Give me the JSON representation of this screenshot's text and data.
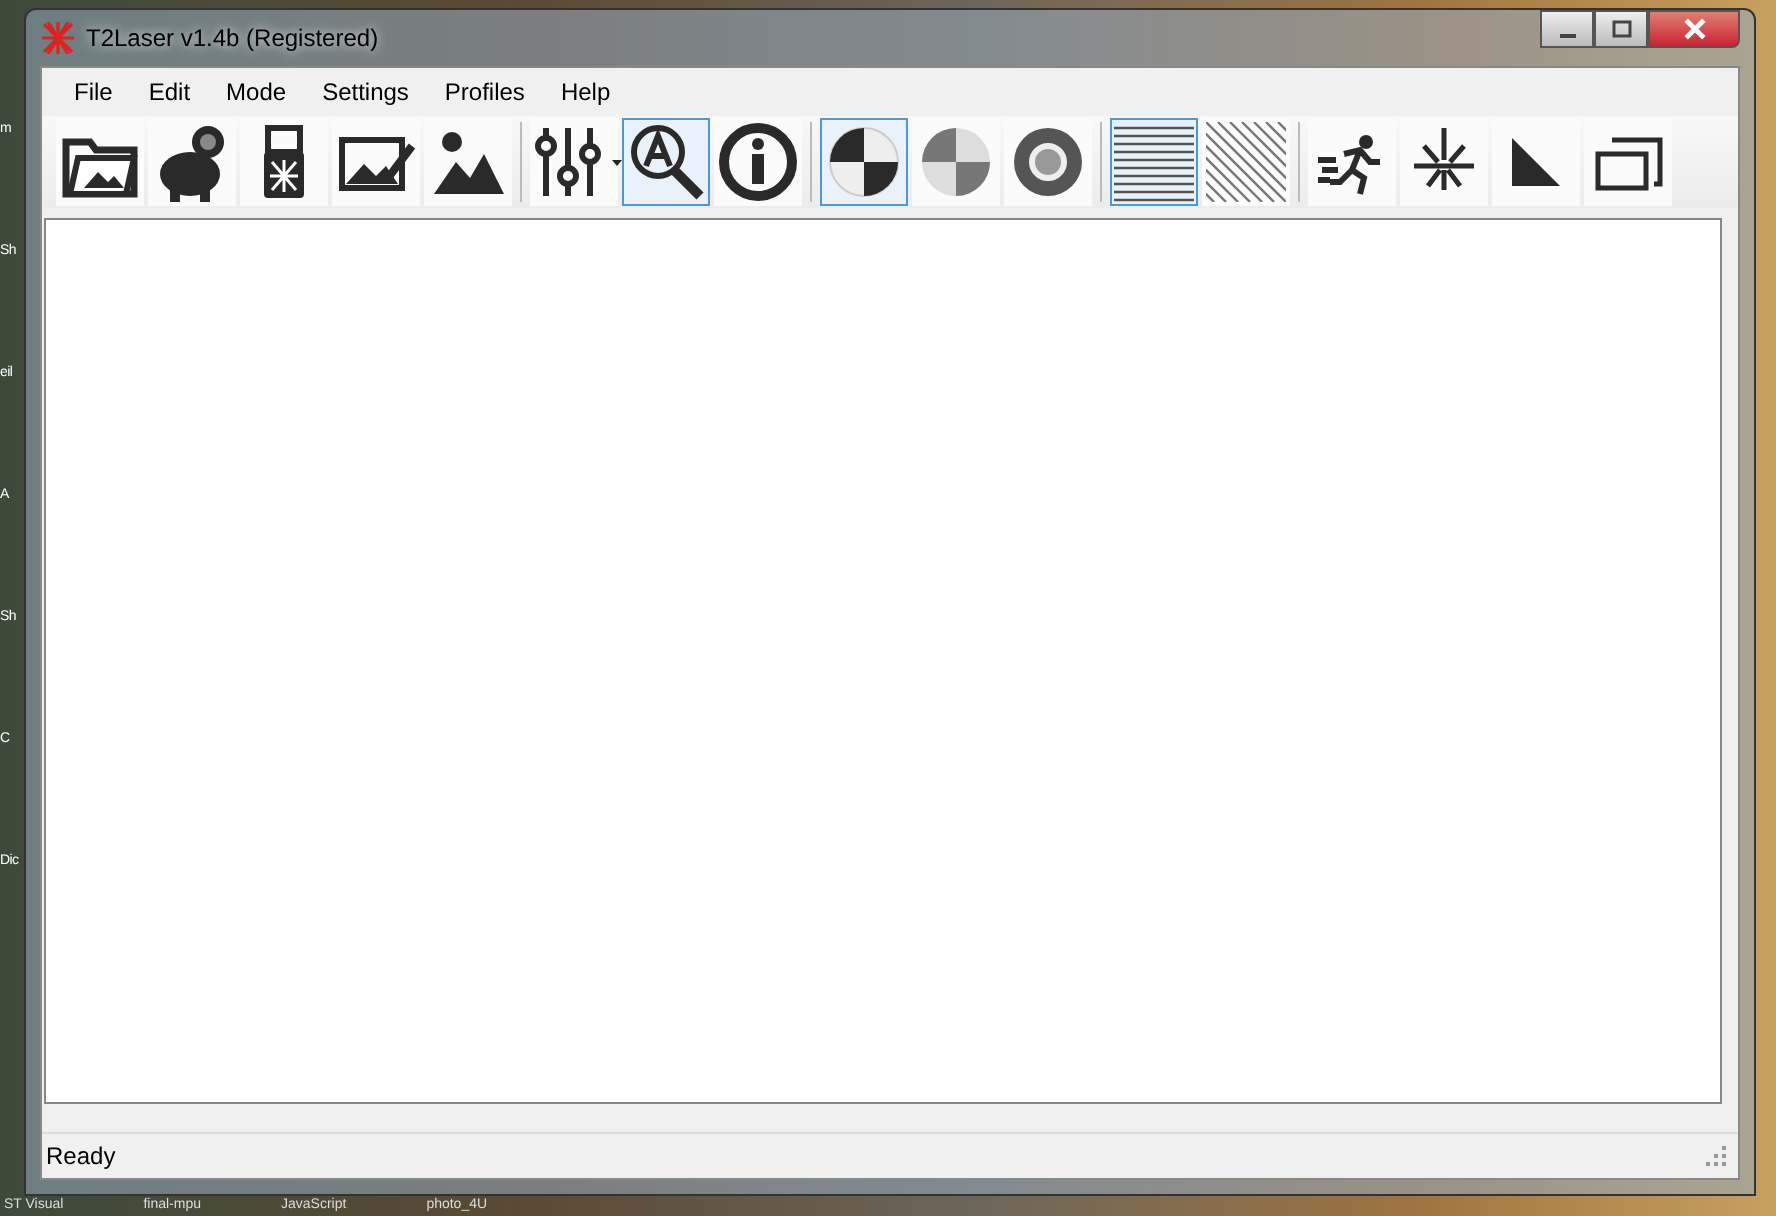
{
  "desktop": {
    "side_labels": [
      "m",
      "Sh",
      "eil",
      "A",
      "Sh",
      "C",
      "Dic"
    ],
    "taskbar_labels": [
      "ST Visual",
      "final-mpu",
      "JavaScript",
      "photo_4U"
    ]
  },
  "window": {
    "title": "T2Laser v1.4b (Registered)"
  },
  "menu": [
    "File",
    "Edit",
    "Mode",
    "Settings",
    "Profiles",
    "Help"
  ],
  "toolbar": [
    [
      {
        "kind": "folder",
        "selected": false
      },
      {
        "kind": "piggy",
        "selected": false
      },
      {
        "kind": "usb",
        "selected": false
      },
      {
        "kind": "edit-image",
        "selected": false
      },
      {
        "kind": "image",
        "selected": false
      }
    ],
    [
      {
        "kind": "sliders",
        "selected": false,
        "dropdown": true
      },
      {
        "kind": "text-zoom",
        "selected": true
      },
      {
        "kind": "info",
        "selected": false
      }
    ],
    [
      {
        "kind": "quarters",
        "selected": true
      },
      {
        "kind": "dither",
        "selected": false
      },
      {
        "kind": "ring",
        "selected": false
      }
    ],
    [
      {
        "kind": "hlines",
        "selected": true
      },
      {
        "kind": "diagonal",
        "selected": false
      }
    ],
    [
      {
        "kind": "runner",
        "selected": false
      },
      {
        "kind": "burst",
        "selected": false
      },
      {
        "kind": "triangle",
        "selected": false
      },
      {
        "kind": "frames",
        "selected": false
      }
    ]
  ],
  "status_bar": {
    "text": "Ready"
  }
}
